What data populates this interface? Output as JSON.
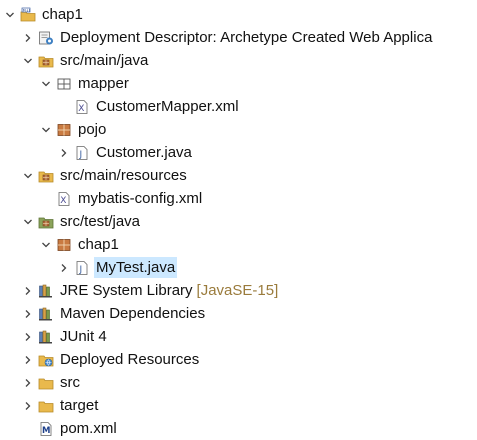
{
  "tree": {
    "project": "chap1",
    "deployment_descriptor": "Deployment Descriptor: Archetype Created Web Applica",
    "src_main_java": "src/main/java",
    "mapper_pkg": "mapper",
    "customer_mapper_xml": "CustomerMapper.xml",
    "pojo_pkg": "pojo",
    "customer_java": "Customer.java",
    "src_main_resources": "src/main/resources",
    "mybatis_config_xml": "mybatis-config.xml",
    "src_test_java": "src/test/java",
    "chap1_pkg": "chap1",
    "mytest_java": "MyTest.java",
    "jre_library": "JRE System Library",
    "jre_version": "[JavaSE-15]",
    "maven_deps": "Maven Dependencies",
    "junit": "JUnit 4",
    "deployed_resources": "Deployed Resources",
    "src": "src",
    "target": "target",
    "pom": "pom.xml"
  },
  "colors": {
    "selection": "#cce8ff",
    "decorator_text": "#9a7b3c",
    "folder": "#e9b94c",
    "package": "#b06a3a"
  }
}
